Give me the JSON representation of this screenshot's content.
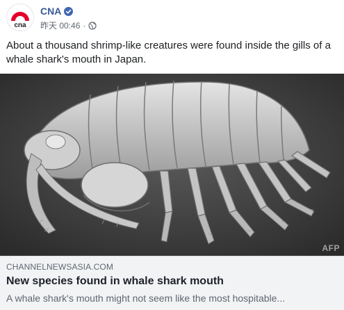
{
  "post": {
    "page_name": "CNA",
    "avatar_text": "cna",
    "timestamp": "昨天 00:46",
    "separator": "·",
    "audience_icon": "globe-icon",
    "verified_icon": "verified-badge-icon",
    "text": "About a thousand shrimp-like creatures were found inside the gills of a whale shark's mouth in Japan."
  },
  "image": {
    "description_icon": "amphipod-photo",
    "watermark": "AFP"
  },
  "link_preview": {
    "domain": "CHANNELNEWSASIA.COM",
    "title": "New species found in whale shark mouth",
    "description": "A whale shark's mouth might not seem like the most hospitable..."
  },
  "colors": {
    "brand_red": "#e4002b",
    "link_blue": "#385898",
    "verified_blue": "#4267b2",
    "meta_grey": "#606770",
    "preview_bg": "#f2f3f5"
  }
}
